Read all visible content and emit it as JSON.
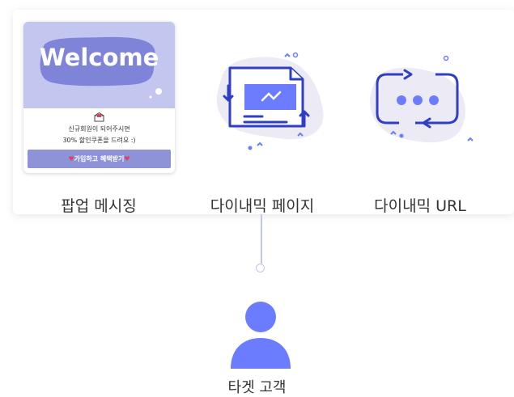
{
  "popup_card": {
    "welcome_text": "Welcome",
    "line1": "신규회원이 되어주시면",
    "line2": "30% 할인쿠폰을 드려요 :)",
    "button_label": "가입하고 혜택받기"
  },
  "features": [
    {
      "label": "팝업 메시징",
      "icon": "popup-card"
    },
    {
      "label": "다이내믹 페이지",
      "icon": "dynamic-page-icon"
    },
    {
      "label": "다이내믹  URL",
      "icon": "dynamic-url-icon"
    }
  ],
  "target": {
    "label": "타겟 고객",
    "icon": "user-icon"
  },
  "colors": {
    "accent": "#6b7cff",
    "icon_blue": "#2f3fc4",
    "lavender": "#c3c6ee",
    "button": "#8e93d8"
  }
}
